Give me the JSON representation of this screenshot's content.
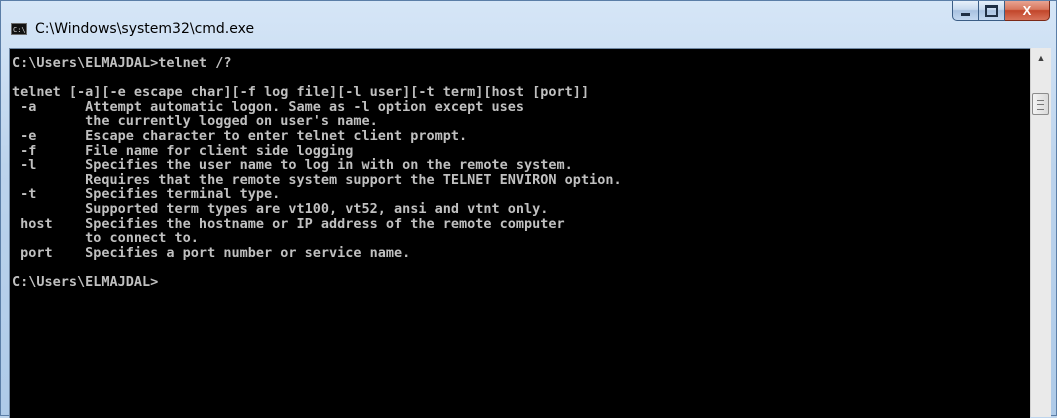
{
  "window": {
    "title": "C:\\Windows\\system32\\cmd.exe",
    "app_icon": "cmd-icon",
    "app_icon_text": "C:\\"
  },
  "caption_buttons": {
    "minimize_icon": "minimize-icon",
    "maximize_icon": "maximize-icon",
    "close_icon": "close-icon",
    "close_glyph": "X"
  },
  "console": {
    "lines": [
      "C:\\Users\\ELMAJDAL>telnet /?",
      "",
      "telnet [-a][-e escape char][-f log file][-l user][-t term][host [port]]",
      " -a      Attempt automatic logon. Same as -l option except uses",
      "         the currently logged on user's name.",
      " -e      Escape character to enter telnet client prompt.",
      " -f      File name for client side logging",
      " -l      Specifies the user name to log in with on the remote system.",
      "         Requires that the remote system support the TELNET ENVIRON option.",
      " -t      Specifies terminal type.",
      "         Supported term types are vt100, vt52, ansi and vtnt only.",
      " host    Specifies the hostname or IP address of the remote computer",
      "         to connect to.",
      " port    Specifies a port number or service name.",
      "",
      "C:\\Users\\ELMAJDAL>"
    ],
    "foreground": "#c0c0c0",
    "background": "#000000"
  },
  "scrollbar": {
    "up_arrow_icon": "scroll-up-arrow-icon",
    "up_arrow_glyph": "▲",
    "thumb_grip_icon": "grip-icon"
  }
}
